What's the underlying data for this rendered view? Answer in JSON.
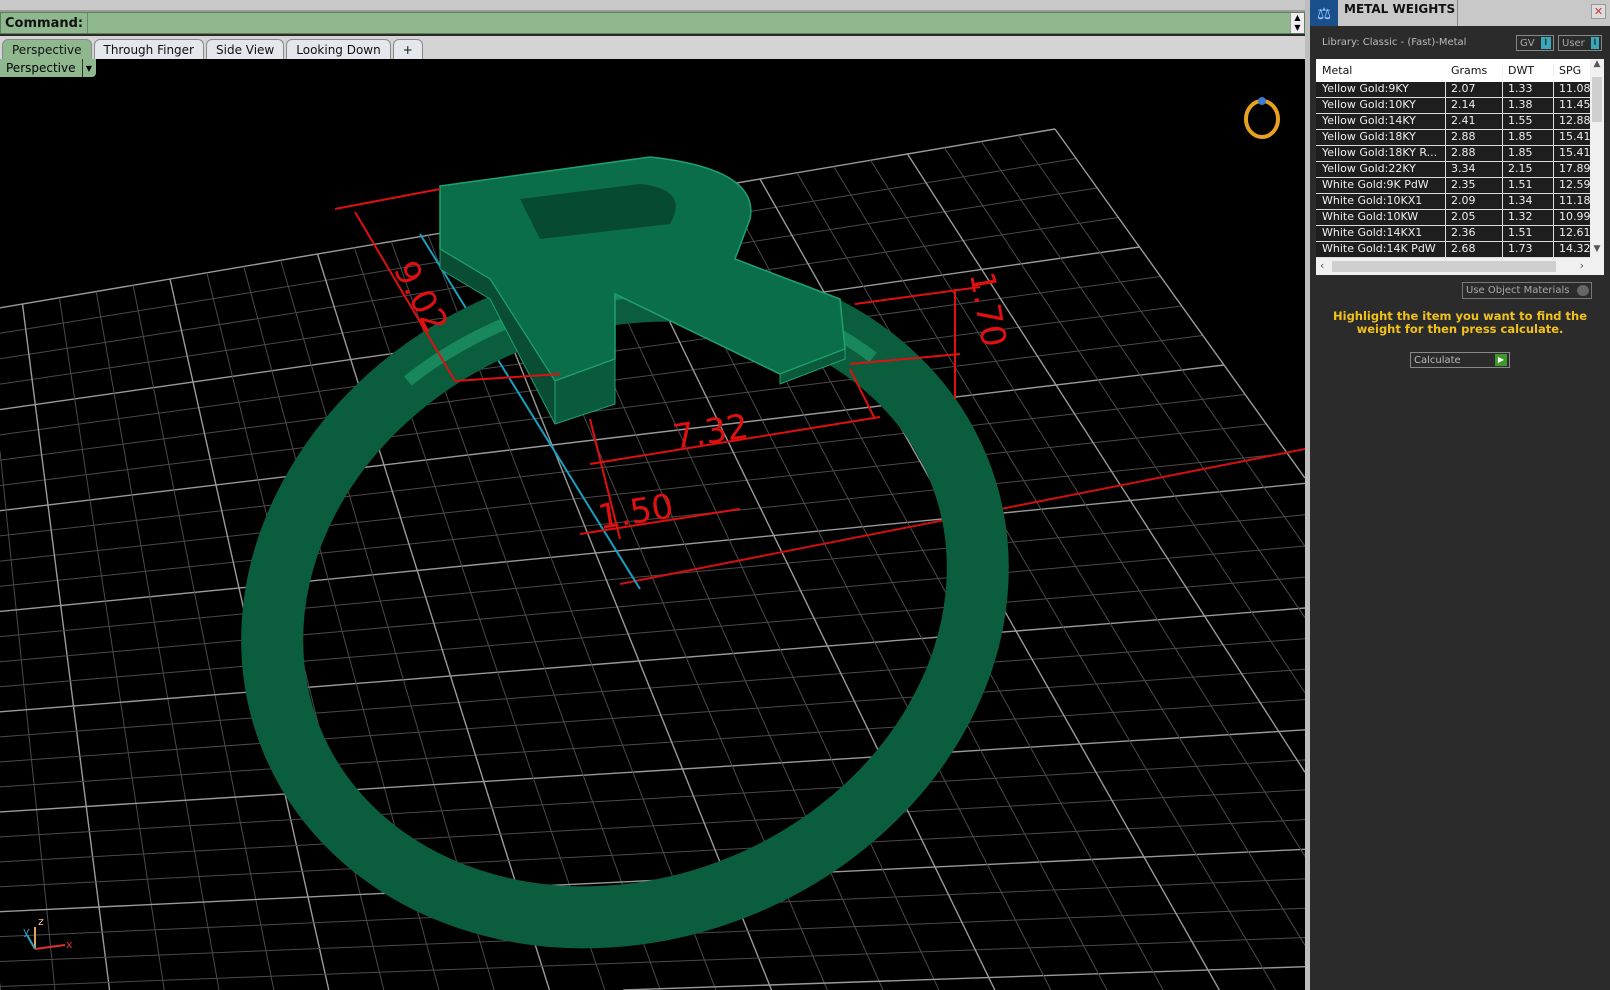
{
  "command": {
    "label": "Command:",
    "value": ""
  },
  "tabs": [
    {
      "label": "Perspective",
      "active": true
    },
    {
      "label": "Through Finger"
    },
    {
      "label": "Side View"
    },
    {
      "label": "Looking Down"
    },
    {
      "label": "+"
    }
  ],
  "viewport": {
    "view_label": "Perspective",
    "dimensions": [
      "9.02",
      "1.70",
      "7.32",
      "1.50"
    ],
    "axes": {
      "z": "z",
      "y": "y",
      "x": "x"
    },
    "model_color": "#0b6e4a",
    "dimension_color": "#e01010"
  },
  "panel": {
    "title": "METAL WEIGHTS",
    "library": "Library: Classic - (Fast)-Metal",
    "toggles": [
      "GV",
      "User"
    ],
    "columns": [
      "Metal",
      "Grams",
      "DWT",
      "SPG"
    ],
    "rows": [
      [
        "Yellow Gold:9KY",
        "2.07",
        "1.33",
        "11.08"
      ],
      [
        "Yellow Gold:10KY",
        "2.14",
        "1.38",
        "11.45"
      ],
      [
        "Yellow Gold:14KY",
        "2.41",
        "1.55",
        "12.88"
      ],
      [
        "Yellow Gold:18KY",
        "2.88",
        "1.85",
        "15.41"
      ],
      [
        "Yellow Gold:18KY R...",
        "2.88",
        "1.85",
        "15.41"
      ],
      [
        "Yellow Gold:22KY",
        "3.34",
        "2.15",
        "17.89"
      ],
      [
        "White Gold:9K PdW",
        "2.35",
        "1.51",
        "12.59"
      ],
      [
        "White Gold:10KX1",
        "2.09",
        "1.34",
        "11.18"
      ],
      [
        "White Gold:10KW",
        "2.05",
        "1.32",
        "10.99"
      ],
      [
        "White Gold:14KX1",
        "2.36",
        "1.51",
        "12.61"
      ],
      [
        "White Gold:14K PdW",
        "2.68",
        "1.73",
        "14.32"
      ]
    ],
    "use_object_materials": "Use Object Materials",
    "message": "Highlight the item you want to find the weight for then press calculate.",
    "calculate": "Calculate",
    "message_color": "#f2c21b"
  }
}
